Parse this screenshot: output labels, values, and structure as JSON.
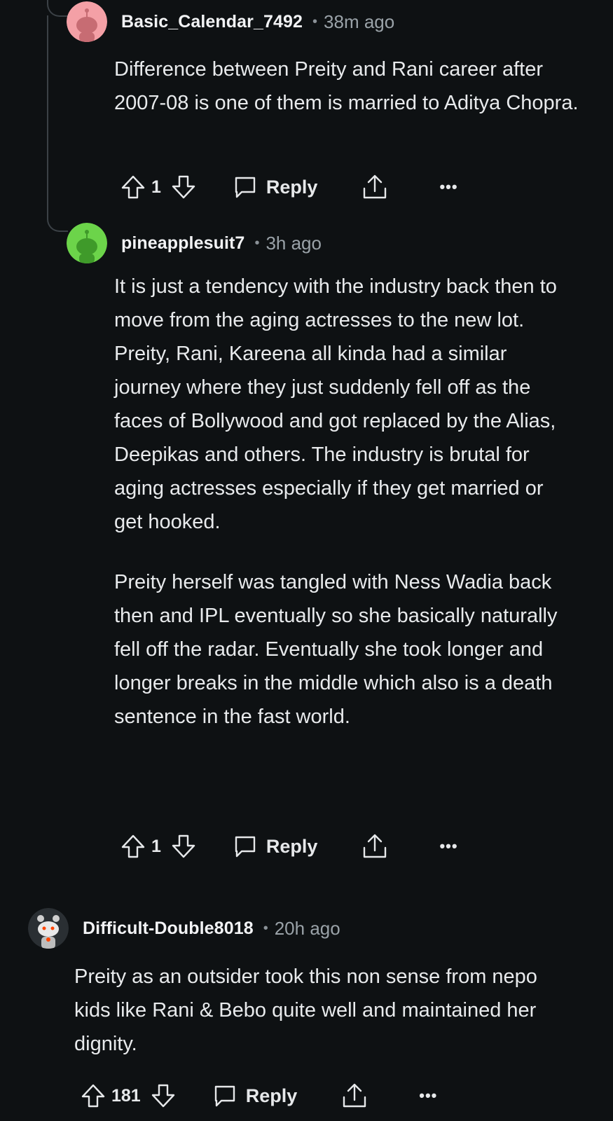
{
  "comments": [
    {
      "username": "Basic_Calendar_7492",
      "time": "38m ago",
      "body": [
        "Difference between Preity and Rani career after 2007-08 is one of them is married to Aditya Chopra."
      ],
      "votes": "1",
      "reply_label": "Reply",
      "more": "•••",
      "avatar_color": "#f4a0a6"
    },
    {
      "username": "pineapplesuit7",
      "time": "3h ago",
      "body": [
        "It is just a tendency with the industry back then to move from the aging actresses to the new lot. Preity, Rani, Kareena all kinda had a similar journey where they just suddenly fell off as the faces of Bollywood and got replaced by the Alias, Deepikas and others. The industry is brutal for aging actresses especially if they get married or get hooked.",
        "Preity herself was tangled with Ness Wadia back then and IPL eventually so she basically naturally fell off the radar. Eventually she took longer and longer breaks in the middle which also is a death sentence in the fast world."
      ],
      "votes": "1",
      "reply_label": "Reply",
      "more": "•••",
      "avatar_color": "#6cd44a"
    },
    {
      "username": "Difficult-Double8018",
      "time": "20h ago",
      "body": [
        "Preity as an outsider took this non sense from nepo kids like Rani & Bebo quite well and maintained her dignity."
      ],
      "votes": "181",
      "reply_label": "Reply",
      "more": "•••",
      "avatar_color": "#2a2f33"
    }
  ],
  "separator": "•"
}
